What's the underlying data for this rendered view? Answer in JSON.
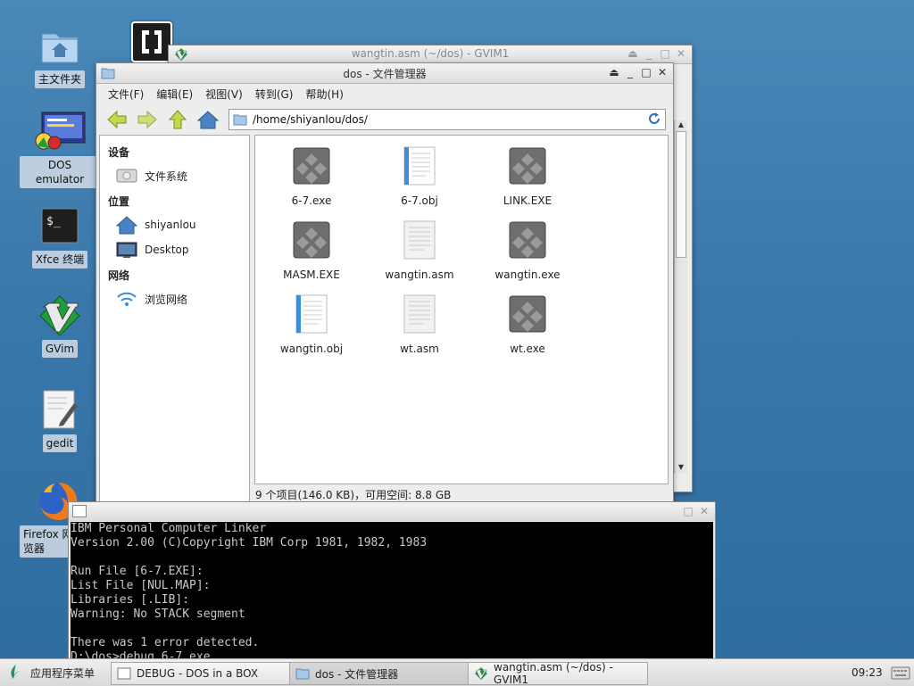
{
  "desktop": {
    "icons": [
      {
        "label": "主文件夹",
        "icon": "home-folder-icon"
      },
      {
        "label": "DOS emulator",
        "icon": "dos-emulator-icon"
      },
      {
        "label": "Xfce 终端",
        "icon": "terminal-icon"
      },
      {
        "label": "GVim",
        "icon": "vim-icon"
      },
      {
        "label": "gedit",
        "icon": "text-editor-icon"
      },
      {
        "label": "Firefox 网\n览器",
        "icon": "firefox-icon"
      }
    ]
  },
  "gvim_window": {
    "title": "wangtin.asm (~/dos) - GVIM1"
  },
  "file_manager": {
    "title": "dos - 文件管理器",
    "menu": [
      "文件(F)",
      "编辑(E)",
      "视图(V)",
      "转到(G)",
      "帮助(H)"
    ],
    "path": "/home/shiyanlou/dos/",
    "sidebar": {
      "sections": [
        {
          "title": "设备",
          "items": [
            {
              "label": "文件系统",
              "icon": "drive-icon"
            }
          ]
        },
        {
          "title": "位置",
          "items": [
            {
              "label": "shiyanlou",
              "icon": "home-icon"
            },
            {
              "label": "Desktop",
              "icon": "desktop-icon"
            }
          ]
        },
        {
          "title": "网络",
          "items": [
            {
              "label": "浏览网络",
              "icon": "network-icon"
            }
          ]
        }
      ]
    },
    "files": [
      {
        "name": "6-7.exe",
        "type": "exe"
      },
      {
        "name": "6-7.obj",
        "type": "obj"
      },
      {
        "name": "LINK.EXE",
        "type": "exe"
      },
      {
        "name": "MASM.EXE",
        "type": "exe"
      },
      {
        "name": "wangtin.asm",
        "type": "asm"
      },
      {
        "name": "wangtin.exe",
        "type": "exe"
      },
      {
        "name": "wangtin.obj",
        "type": "obj"
      },
      {
        "name": "wt.asm",
        "type": "asm"
      },
      {
        "name": "wt.exe",
        "type": "exe"
      }
    ],
    "status": "9 个项目(146.0 KB)，可用空间: 8.8 GB"
  },
  "dosbox": {
    "lines": [
      "IBM Personal Computer Linker",
      "Version 2.00 (C)Copyright IBM Corp 1981, 1982, 1983",
      "",
      "Run File [6-7.EXE]:",
      "List File [NUL.MAP]:",
      "Libraries [.LIB]:",
      "Warning: No STACK segment",
      "",
      "There was 1 error detected.",
      "D:\\dos>debug 6-7.exe"
    ]
  },
  "taskbar": {
    "menu_label": "应用程序菜单",
    "tasks": [
      {
        "label": "DEBUG - DOS in a BOX",
        "icon": "dosbox-icon",
        "active": false
      },
      {
        "label": "dos - 文件管理器",
        "icon": "folder-icon",
        "active": true
      },
      {
        "label": "wangtin.asm (~/dos) - GVIM1",
        "icon": "vim-icon",
        "active": false
      }
    ],
    "clock": "09:23"
  }
}
